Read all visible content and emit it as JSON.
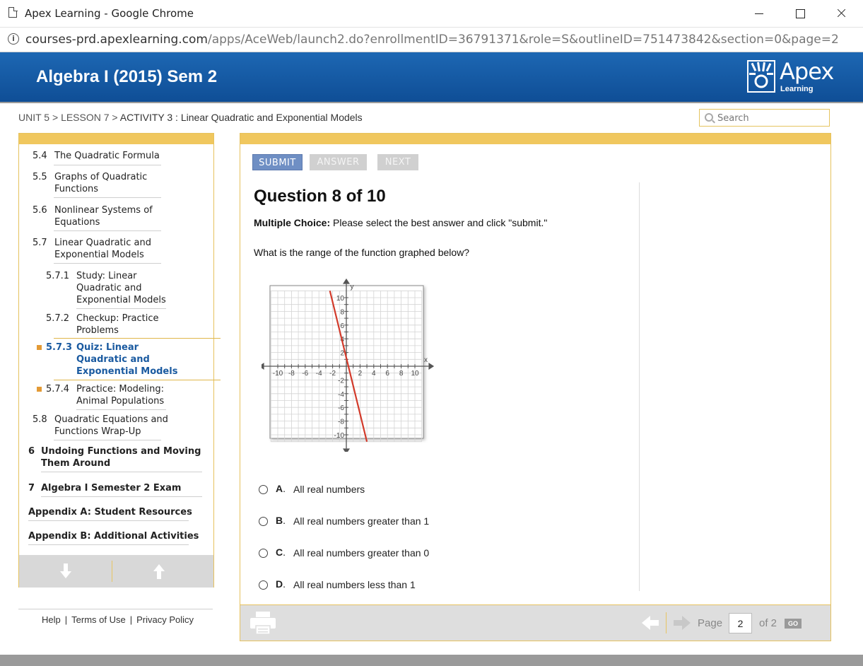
{
  "window": {
    "title": "Apex Learning - Google Chrome"
  },
  "address": {
    "host": "courses-prd.apexlearning.com",
    "path": "/apps/AceWeb/launch2.do?enrollmentID=36791371&role=S&outlineID=751473842&section=0&page=2"
  },
  "header": {
    "course_title": "Algebra I (2015) Sem 2",
    "logo_text": "Apex",
    "logo_sub": "Learning"
  },
  "breadcrumb": {
    "unit": "UNIT 5",
    "sep": " > ",
    "lesson": "LESSON 7",
    "activity": "ACTIVITY 3",
    "colon": " : ",
    "activity_title": "Linear Quadratic and Exponential Models"
  },
  "search": {
    "placeholder": "Search"
  },
  "sidebar": {
    "items": [
      {
        "num": "5.4",
        "label_1": "The Quadratic Formula"
      },
      {
        "num": "5.5",
        "label_1": "Graphs of Quadratic",
        "label_2": "Functions"
      },
      {
        "num": "5.6",
        "label_1": "Nonlinear Systems of",
        "label_2": "Equations"
      },
      {
        "num": "5.7",
        "label_1": "Linear Quadratic and",
        "label_2": "Exponential Models"
      },
      {
        "num": "5.7.1",
        "label_1": "Study: Linear",
        "label_2": "Quadratic and",
        "label_3": "Exponential Models"
      },
      {
        "num": "5.7.2",
        "label_1": "Checkup: Practice",
        "label_2": "Problems"
      },
      {
        "num": "5.7.3",
        "label_1": "Quiz: Linear",
        "label_2": "Quadratic and",
        "label_3": "Exponential Models"
      },
      {
        "num": "5.7.4",
        "label_1": "Practice: Modeling:",
        "label_2": "Animal Populations"
      },
      {
        "num": "5.8",
        "label_1": "Quadratic Equations and",
        "label_2": "Functions Wrap-Up"
      },
      {
        "num": "6",
        "label_1": "Undoing Functions and Moving",
        "label_2": "Them Around"
      },
      {
        "num": "7",
        "label_1": "Algebra I Semester 2 Exam"
      },
      {
        "label_1": "Appendix A: Student Resources"
      },
      {
        "label_1": "Appendix B: Additional Activities"
      }
    ]
  },
  "footer": {
    "help": "Help",
    "terms": "Terms of Use",
    "privacy": "Privacy Policy",
    "pipe": "|"
  },
  "toolbar": {
    "submit": "SUBMIT",
    "answer": "ANSWER",
    "next": "NEXT"
  },
  "question": {
    "title": "Question 8 of 10",
    "instr_bold": "Multiple Choice:",
    "instr_rest": " Please select the best answer and click \"submit.\"",
    "text": "What is the range of the function graphed below?",
    "choices": [
      {
        "letter": "A",
        "text": "All real numbers"
      },
      {
        "letter": "B",
        "text": "All real numbers greater than 1"
      },
      {
        "letter": "C",
        "text": "All real numbers greater than 0"
      },
      {
        "letter": "D",
        "text": "All real numbers less than 1"
      }
    ]
  },
  "graph": {
    "x_axis_label": "x",
    "y_axis_label": "y",
    "x_ticks": [
      "-10",
      "-8",
      "-6",
      "-4",
      "-2",
      "2",
      "4",
      "6",
      "8",
      "10"
    ],
    "y_ticks": [
      "10",
      "8",
      "6",
      "4",
      "2",
      "-2",
      "-4",
      "-6",
      "-8",
      "-10"
    ],
    "line": {
      "color": "#d23a2a",
      "points": [
        [
          -2.4,
          11
        ],
        [
          3.0,
          -11
        ]
      ]
    }
  },
  "pager": {
    "label": "Page",
    "value": "2",
    "of": "of 2",
    "go": "GO"
  },
  "colors": {
    "header_blue": "#1560ad",
    "accent_gold": "#f0c75e",
    "submit_blue": "#6f8fc4",
    "active_link": "#1a5aa0"
  }
}
